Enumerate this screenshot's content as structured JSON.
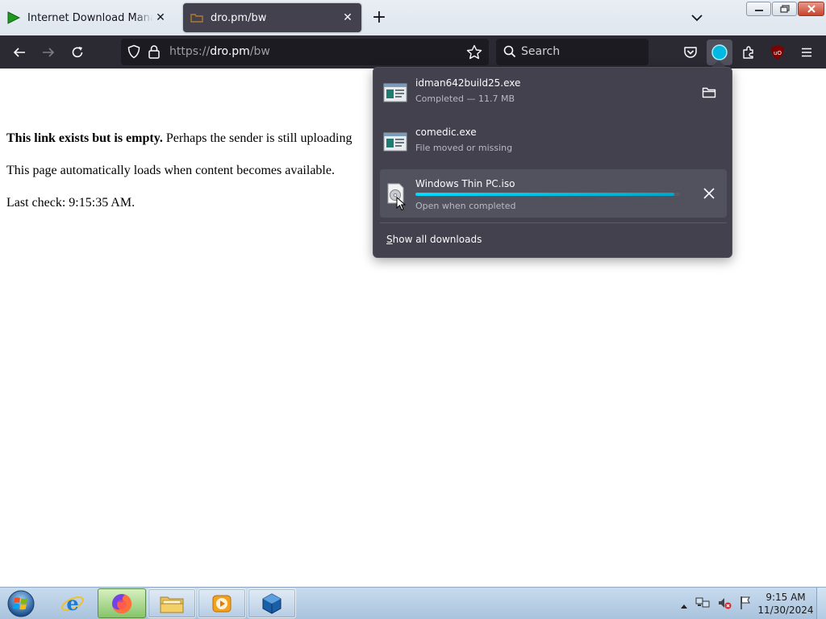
{
  "tabs": [
    {
      "title": "Internet Download Manager is a",
      "state": "inactive",
      "favicon": "idm-play-icon"
    },
    {
      "title": "dro.pm/bw",
      "state": "active",
      "favicon": "dropm-icon"
    }
  ],
  "toolbar": {
    "url_scheme": "https://",
    "url_host": "dro.pm",
    "url_path": "/bw",
    "search_placeholder": "Search"
  },
  "page": {
    "line1_bold": "This link exists but is empty.",
    "line1_rest": " Perhaps the sender is still uploading",
    "line2": "This page automatically loads when content becomes available.",
    "line3": "Last check: 9:15:35 AM."
  },
  "downloads": {
    "items": [
      {
        "name": "idman642build25.exe",
        "status": "Completed — 11.7 MB",
        "action": "folder-icon"
      },
      {
        "name": "comedic.exe",
        "status": "File moved or missing",
        "action": ""
      },
      {
        "name": "Windows Thin PC.iso",
        "status": "Open when completed",
        "action": "cancel-icon",
        "progress": 0.98
      }
    ],
    "show_all_prefix": "S",
    "show_all_rest": "how all downloads"
  },
  "taskbar": {
    "time": "9:15 AM",
    "date": "11/30/2024",
    "apps": [
      "internet-explorer-icon",
      "firefox-icon",
      "file-explorer-icon",
      "media-player-icon",
      "virtualbox-icon"
    ]
  },
  "colors": {
    "toolbar_bg": "#2b2a33",
    "panel_bg": "#42414d",
    "progress_accent": "#00ddff",
    "tab_active_bg": "#42414d"
  }
}
